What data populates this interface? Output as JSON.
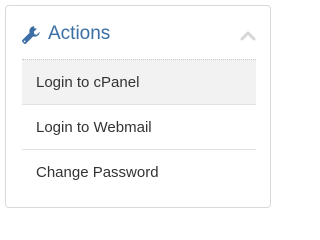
{
  "panel": {
    "title": "Actions",
    "header_icon": "wrench-icon",
    "collapse_icon": "chevron-up-icon",
    "accent_color": "#3a6ea5",
    "items": [
      {
        "label": "Login to cPanel",
        "active": true
      },
      {
        "label": "Login to Webmail",
        "active": false
      },
      {
        "label": "Change Password",
        "active": false
      }
    ]
  }
}
